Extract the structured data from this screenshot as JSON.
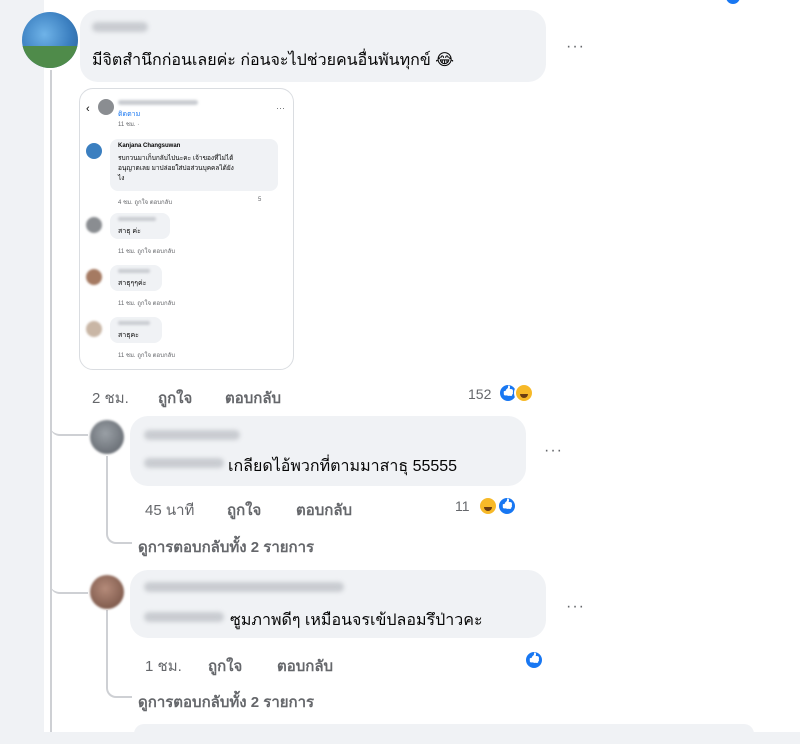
{
  "main_comment": {
    "text": "มีจิตสำนึกก่อนเลยค่ะ ก่อนจะไปช่วยคนอื่นพันทุกข์ 😂",
    "time": "2 ชม.",
    "like_label": "ถูกใจ",
    "reply_label": "ตอบกลับ",
    "reaction_count": "152"
  },
  "attached_image": {
    "follow_label": "ติดตาม",
    "time": "11 ชม. · ",
    "comments": [
      {
        "name": "Kanjana Changsuwan",
        "text": "รบกวนมาเก็บกลับไปนะคะ เจ้าของที่ไม่ได้",
        "text2": "อนุญาตเลย มาปล่อยใส่บ่อส่วนบุคคลได้ยัง",
        "text3": "ไง",
        "meta": "4 ชม.  ถูกใจ  ตอบกลับ",
        "count": "5"
      },
      {
        "text": "สาธุ ค่ะ",
        "meta": "11 ชม.  ถูกใจ  ตอบกลับ"
      },
      {
        "text": "สาธุๆๆค่ะ",
        "meta": "11 ชม.  ถูกใจ  ตอบกลับ"
      },
      {
        "text": "สาธุคะ",
        "meta": "11 ชม.  ถูกใจ  ตอบกลับ"
      }
    ]
  },
  "replies": [
    {
      "text": "เกลียดไอ้พวกที่ตามมาสาธุ 55555",
      "time": "45 นาที",
      "like_label": "ถูกใจ",
      "reply_label": "ตอบกลับ",
      "reaction_count": "11",
      "view_replies": "ดูการตอบกลับทั้ง 2 รายการ"
    },
    {
      "text": "ซูมภาพดีๆ เหมือนจรเข้ปลอมรึป่าวคะ",
      "time": "1 ชม.",
      "like_label": "ถูกใจ",
      "reply_label": "ตอบกลับ",
      "view_replies": "ดูการตอบกลับทั้ง 2 รายการ"
    }
  ],
  "more_label": "···",
  "colors": {
    "accent": "#1877f2",
    "bubble": "#f0f2f5",
    "muted": "#65676b"
  }
}
